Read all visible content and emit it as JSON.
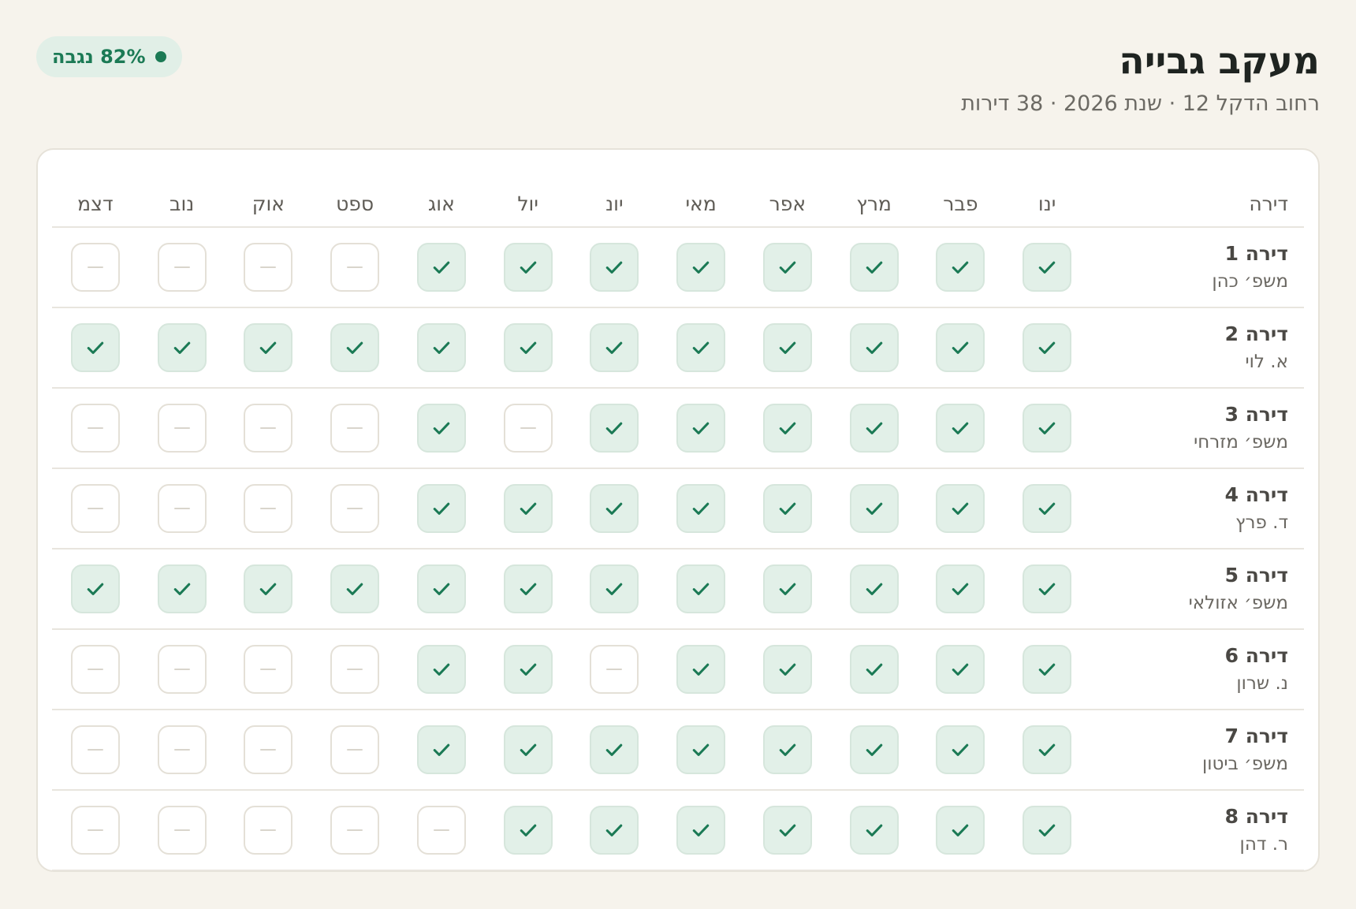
{
  "header": {
    "title": "מעקב גבייה",
    "subtitle": "רחוב הדקל 12 · שנת 2026 · 38 דירות",
    "badge": "82% נגבה"
  },
  "colors": {
    "accent": "#1b7a55",
    "paid_bg": "#e2f0e8",
    "background": "#f6f3ec"
  },
  "table": {
    "apartment_header": "דירה",
    "months": [
      "ינו",
      "פבר",
      "מרץ",
      "אפר",
      "מאי",
      "יונ",
      "יול",
      "אוג",
      "ספט",
      "אוק",
      "נוב",
      "דצמ"
    ],
    "rows": [
      {
        "name": "דירה 1",
        "owner": "משפ׳ כהן",
        "paid": [
          true,
          true,
          true,
          true,
          true,
          true,
          true,
          true,
          false,
          false,
          false,
          false
        ]
      },
      {
        "name": "דירה 2",
        "owner": "א. לוי",
        "paid": [
          true,
          true,
          true,
          true,
          true,
          true,
          true,
          true,
          true,
          true,
          true,
          true
        ]
      },
      {
        "name": "דירה 3",
        "owner": "משפ׳ מזרחי",
        "paid": [
          true,
          true,
          true,
          true,
          true,
          true,
          false,
          true,
          false,
          false,
          false,
          false
        ]
      },
      {
        "name": "דירה 4",
        "owner": "ד. פרץ",
        "paid": [
          true,
          true,
          true,
          true,
          true,
          true,
          true,
          true,
          false,
          false,
          false,
          false
        ]
      },
      {
        "name": "דירה 5",
        "owner": "משפ׳ אזולאי",
        "paid": [
          true,
          true,
          true,
          true,
          true,
          true,
          true,
          true,
          true,
          true,
          true,
          true
        ]
      },
      {
        "name": "דירה 6",
        "owner": "נ. שרון",
        "paid": [
          true,
          true,
          true,
          true,
          true,
          false,
          true,
          true,
          false,
          false,
          false,
          false
        ]
      },
      {
        "name": "דירה 7",
        "owner": "משפ׳ ביטון",
        "paid": [
          true,
          true,
          true,
          true,
          true,
          true,
          true,
          true,
          false,
          false,
          false,
          false
        ]
      },
      {
        "name": "דירה 8",
        "owner": "ר. דהן",
        "paid": [
          true,
          true,
          true,
          true,
          true,
          true,
          true,
          false,
          false,
          false,
          false,
          false
        ]
      }
    ]
  }
}
